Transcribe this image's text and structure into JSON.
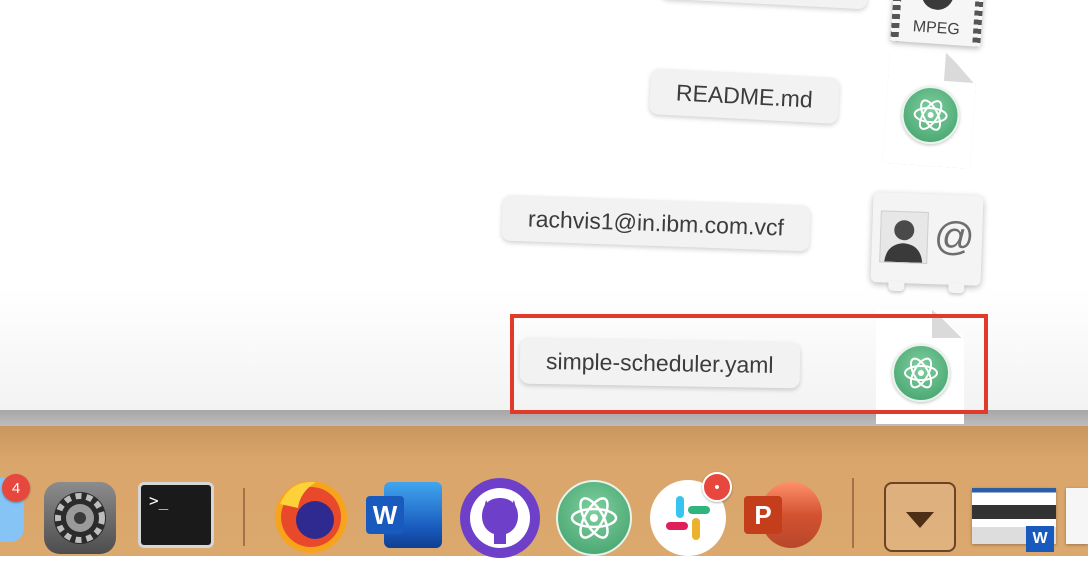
{
  "stack": {
    "files": [
      {
        "name": "MPEG",
        "kind": "video"
      },
      {
        "name": "README.md",
        "kind": "atom-document"
      },
      {
        "name": "rachvis1@in.ibm.com.vcf",
        "kind": "contact-card"
      },
      {
        "name": "simple-scheduler.yaml",
        "kind": "atom-document",
        "highlighted": true
      }
    ],
    "mpeg_label": "MPEG",
    "contact_at_symbol": "@"
  },
  "dock": {
    "apps": [
      {
        "name": "Finder",
        "icon": "finder-icon",
        "badge": "4"
      },
      {
        "name": "System Preferences",
        "icon": "system-preferences-icon"
      },
      {
        "name": "Terminal",
        "icon": "terminal-icon",
        "label": ">_"
      },
      {
        "name": "Firefox",
        "icon": "firefox-icon"
      },
      {
        "name": "Microsoft Word",
        "icon": "word-icon",
        "label": "W"
      },
      {
        "name": "GitHub Desktop",
        "icon": "github-icon"
      },
      {
        "name": "Atom",
        "icon": "atom-icon"
      },
      {
        "name": "Slack",
        "icon": "slack-icon",
        "badge": "•"
      },
      {
        "name": "PowerPoint",
        "icon": "powerpoint-icon",
        "label": "P"
      },
      {
        "name": "Downloads",
        "icon": "downloads-stack-icon"
      },
      {
        "name": "Document thumbnail",
        "icon": "document-thumbnail-icon",
        "label": "W"
      }
    ]
  },
  "colors": {
    "selection": "#e03a2b",
    "atom_green": "#4fae77",
    "dock": "#d9a56b"
  }
}
